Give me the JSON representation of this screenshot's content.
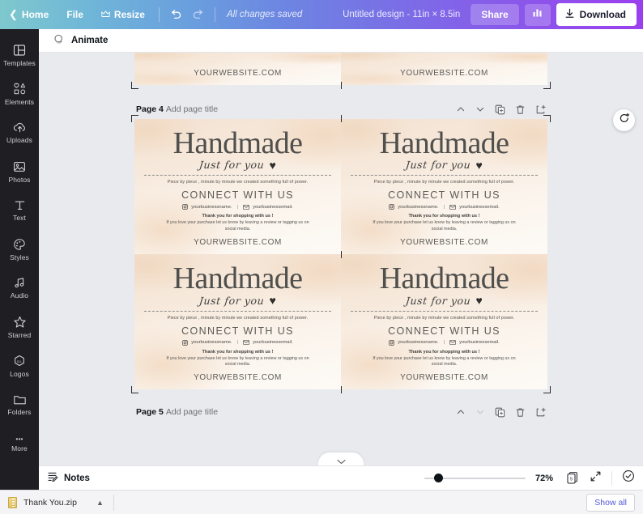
{
  "topbar": {
    "back_icon": "chevron-left-icon",
    "home_label": "Home",
    "file_label": "File",
    "resize_label": "Resize",
    "resize_icon": "crown-icon",
    "undo_icon": "undo-icon",
    "redo_icon": "redo-icon",
    "saved_status": "All changes saved",
    "design_title": "Untitled design - 11in × 8.5in",
    "share_label": "Share",
    "insights_icon": "bar-chart-icon",
    "download_label": "Download",
    "download_icon": "download-icon",
    "gradient_from": "#7ec8cd",
    "gradient_to": "#9b3fef"
  },
  "sidebar": {
    "items": [
      {
        "label": "Templates",
        "icon": "templates-icon"
      },
      {
        "label": "Elements",
        "icon": "elements-icon"
      },
      {
        "label": "Uploads",
        "icon": "upload-cloud-icon"
      },
      {
        "label": "Photos",
        "icon": "photo-icon"
      },
      {
        "label": "Text",
        "icon": "text-icon"
      },
      {
        "label": "Styles",
        "icon": "palette-icon"
      },
      {
        "label": "Audio",
        "icon": "music-note-icon"
      },
      {
        "label": "Starred",
        "icon": "star-icon"
      },
      {
        "label": "Logos",
        "icon": "logo-hexagon-icon"
      },
      {
        "label": "Folders",
        "icon": "folder-icon"
      },
      {
        "label": "More",
        "icon": "more-dots-icon"
      }
    ]
  },
  "subbar": {
    "animate_label": "Animate",
    "animate_icon": "animate-circles-icon"
  },
  "canvas": {
    "comment_fab_icon": "add-comment-icon",
    "page_head_icons": [
      {
        "name": "move-page-up-icon",
        "glyph": "chevron-up"
      },
      {
        "name": "move-page-down-icon",
        "glyph": "chevron-down"
      },
      {
        "name": "duplicate-page-icon",
        "glyph": "duplicate"
      },
      {
        "name": "delete-page-icon",
        "glyph": "trash"
      },
      {
        "name": "add-page-icon",
        "glyph": "add-page"
      }
    ],
    "pages": [
      {
        "label": "Page 4",
        "title_placeholder": "Add page title"
      },
      {
        "label": "Page 5",
        "title_placeholder": "Add page title"
      }
    ]
  },
  "card": {
    "title": "Handmade",
    "script": "Just for you",
    "heart": "♥",
    "tagline": "Piece by piece , minute by minute we created something full of power.",
    "connect": "CONNECT WITH US",
    "instagram_handle": "yourbusinessname.",
    "social_divider": "|",
    "email_handle": "yourbusinessemail.",
    "instagram_icon": "instagram-icon",
    "email_icon": "envelope-icon",
    "thanks": "Thank you for shopping with us !",
    "note": "If you love your purchase let us know by leaving a review or tagging us on social media.",
    "website": "YOURWEBSITE.COM"
  },
  "statusbar": {
    "notes_label": "Notes",
    "notes_icon": "notes-icon",
    "zoom_value": "72%",
    "page_count": "5",
    "pages_icon": "pages-icon",
    "fullscreen_icon": "expand-icon",
    "help_icon": "help-check-icon"
  },
  "shelf": {
    "file_name": "Thank You.zip",
    "file_icon": "zip-file-icon",
    "caret_icon": "chevron-up-icon",
    "show_all_label": "Show all"
  }
}
